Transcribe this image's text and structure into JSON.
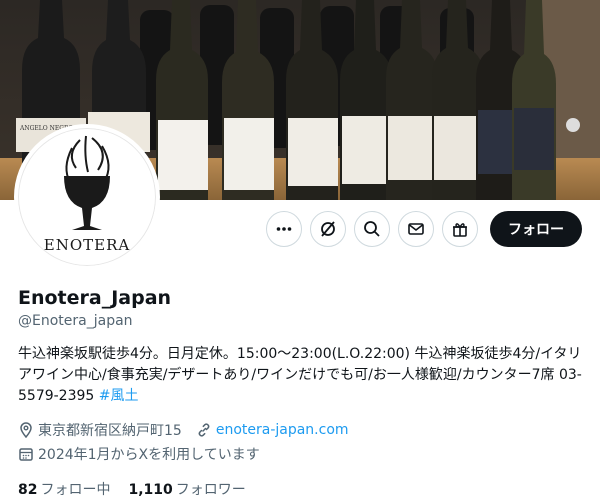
{
  "banner": {
    "bottle_label_text": "ANGELO NEGRO"
  },
  "avatar": {
    "logo_text": "ENOTERA"
  },
  "actions": {
    "more_icon": "more-horizontal-icon",
    "grok_icon": "grok-icon",
    "search_icon": "search-icon",
    "message_icon": "mail-icon",
    "subscribe_icon": "gift-icon",
    "follow_label": "フォロー"
  },
  "profile": {
    "display_name": "Enotera_Japan",
    "handle": "@Enotera_japan",
    "bio": "牛込神楽坂駅徒歩4分。日月定休。15:00～23:00(L.O.22:00) 牛込神楽坂徒歩4分/イタリアワイン中心/食事充実/デザートあり/ワインだけでも可/お一人様歓迎/カウンター7席 03-5579-2395 ",
    "hashtag": "#風土",
    "location": "東京都新宿区納戸町15",
    "website": "enotera-japan.com",
    "joined": "2024年1月からXを利用しています"
  },
  "stats": {
    "following_count": "82",
    "following_label": "フォロー中",
    "followers_count": "1,110",
    "followers_label": "フォロワー"
  },
  "colors": {
    "accent": "#1d9bf0",
    "follow_button_bg": "#0f1419",
    "secondary_text": "#536471"
  }
}
